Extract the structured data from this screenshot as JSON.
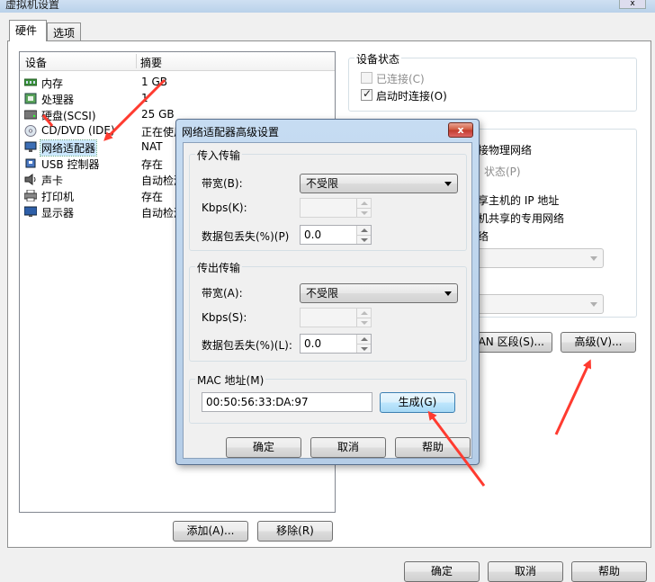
{
  "window": {
    "title": "虚拟机设置",
    "close": "x"
  },
  "tabs": [
    {
      "label": "硬件"
    },
    {
      "label": "选项"
    }
  ],
  "device_list": {
    "headers": {
      "device": "设备",
      "summary": "摘要"
    },
    "rows": [
      {
        "name": "内存",
        "summary": "1 GB",
        "icon": "memory-icon"
      },
      {
        "name": "处理器",
        "summary": "1",
        "icon": "processor-icon"
      },
      {
        "name": "硬盘(SCSI)",
        "summary": "25 GB",
        "icon": "harddisk-icon"
      },
      {
        "name": "CD/DVD (IDE)",
        "summary": "正在使用",
        "icon": "cd-dvd-icon"
      },
      {
        "name": "网络适配器",
        "summary": "NAT",
        "icon": "network-adapter-icon"
      },
      {
        "name": "USB 控制器",
        "summary": "存在",
        "icon": "usb-icon"
      },
      {
        "name": "声卡",
        "summary": "自动检测",
        "icon": "sound-card-icon"
      },
      {
        "name": "打印机",
        "summary": "存在",
        "icon": "printer-icon"
      },
      {
        "name": "显示器",
        "summary": "自动检测",
        "icon": "display-icon"
      }
    ],
    "add_button": "添加(A)...",
    "remove_button": "移除(R)"
  },
  "device_status": {
    "title": "设备状态",
    "connected": {
      "label": "已连接(C)",
      "checked": false,
      "disabled": true
    },
    "connect_at_power_on": {
      "label": "启动时连接(O)",
      "checked": true
    }
  },
  "network_partial": {
    "line1": "接物理网络",
    "line2": "状态(P)",
    "line3": "享主机的 IP 地址",
    "line4": "机共享的专用网络",
    "line5": "络",
    "lan_segment_button": "AN 区段(S)...",
    "advanced_button": "高级(V)..."
  },
  "dialog": {
    "title": "网络适配器高级设置",
    "close": "x",
    "incoming": {
      "title": "传入传输",
      "bandwidth_label": "带宽(B):",
      "bandwidth_value": "不受限",
      "kbps_label": "Kbps(K):",
      "kbps_value": "",
      "loss_label": "数据包丢失(%)(P)",
      "loss_value": "0.0"
    },
    "outgoing": {
      "title": "传出传输",
      "bandwidth_label": "带宽(A):",
      "bandwidth_value": "不受限",
      "kbps_label": "Kbps(S):",
      "kbps_value": "",
      "loss_label": "数据包丢失(%)(L):",
      "loss_value": "0.0"
    },
    "mac": {
      "title": "MAC 地址(M)",
      "value": "00:50:56:33:DA:97",
      "generate_button": "生成(G)"
    },
    "ok": "确定",
    "cancel": "取消",
    "help": "帮助"
  },
  "footer": {
    "ok": "确定",
    "cancel": "取消",
    "help": "帮助"
  },
  "colors": {
    "annotation_arrow": "#ff3b30",
    "selection": "#cce8ff"
  }
}
